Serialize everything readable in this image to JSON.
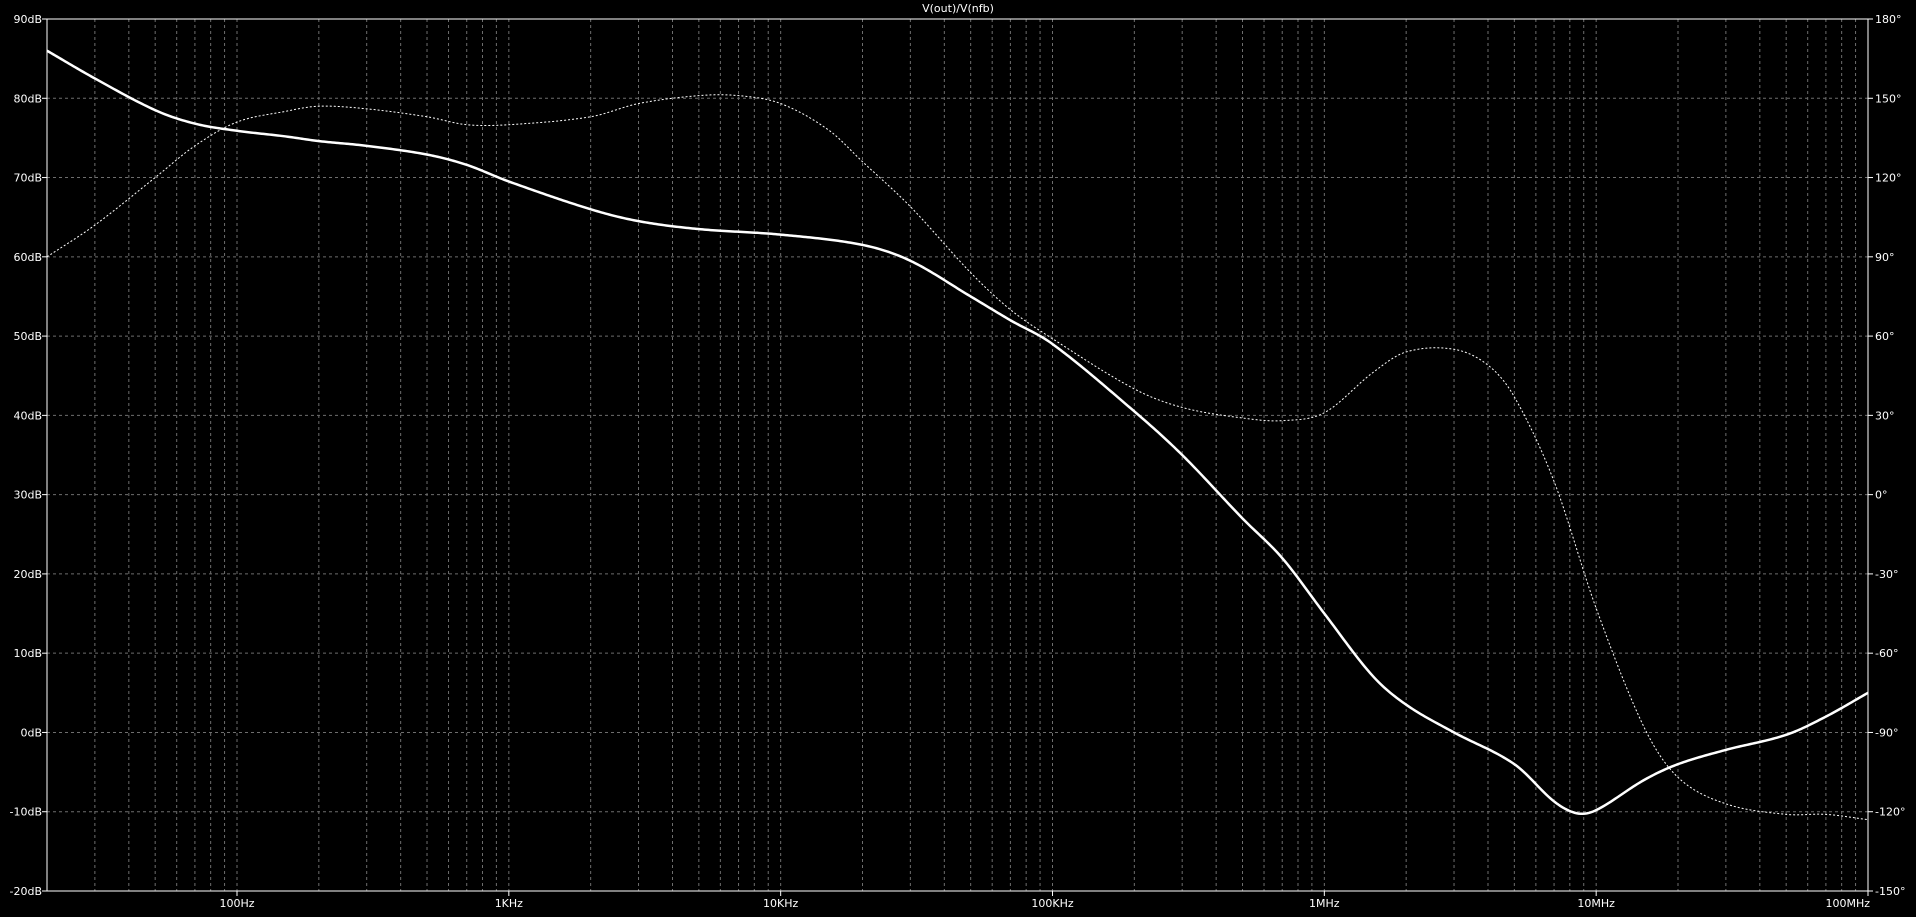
{
  "chart_data": {
    "type": "line",
    "title": "V(out)/V(nfb)",
    "x_scale": "log",
    "xlim": [
      20,
      100000000
    ],
    "ylim_left": [
      -20,
      90
    ],
    "ylim_right": [
      -150,
      180
    ],
    "left_ticks": [
      {
        "v": 90,
        "label": "90dB"
      },
      {
        "v": 80,
        "label": "80dB"
      },
      {
        "v": 70,
        "label": "70dB"
      },
      {
        "v": 60,
        "label": "60dB"
      },
      {
        "v": 50,
        "label": "50dB"
      },
      {
        "v": 40,
        "label": "40dB"
      },
      {
        "v": 30,
        "label": "30dB"
      },
      {
        "v": 20,
        "label": "20dB"
      },
      {
        "v": 10,
        "label": "10dB"
      },
      {
        "v": 0,
        "label": "0dB"
      },
      {
        "v": -10,
        "label": "-10dB"
      },
      {
        "v": -20,
        "label": "-20dB"
      }
    ],
    "right_ticks": [
      {
        "v": 180,
        "label": "180°"
      },
      {
        "v": 150,
        "label": "150°"
      },
      {
        "v": 120,
        "label": "120°"
      },
      {
        "v": 90,
        "label": "90°"
      },
      {
        "v": 60,
        "label": "60°"
      },
      {
        "v": 30,
        "label": "30°"
      },
      {
        "v": 0,
        "label": "0°"
      },
      {
        "v": -30,
        "label": "-30°"
      },
      {
        "v": -60,
        "label": "-60°"
      },
      {
        "v": -90,
        "label": "-90°"
      },
      {
        "v": -120,
        "label": "-120°"
      },
      {
        "v": -150,
        "label": "-150°"
      }
    ],
    "x_ticks": [
      {
        "v": 100,
        "label": "100Hz"
      },
      {
        "v": 1000,
        "label": "1KHz"
      },
      {
        "v": 10000,
        "label": "10KHz"
      },
      {
        "v": 100000,
        "label": "100KHz"
      },
      {
        "v": 1000000,
        "label": "1MHz"
      },
      {
        "v": 10000000,
        "label": "10MHz"
      },
      {
        "v": 100000000,
        "label": "100MHz"
      }
    ],
    "grid": true,
    "colors": {
      "background": "#000000",
      "trace": "#ffffff",
      "grid": "#6e6e6e"
    },
    "series": [
      {
        "axis": "left",
        "style": "solid",
        "x": [
          20,
          30,
          50,
          70,
          100,
          150,
          200,
          300,
          500,
          700,
          1000,
          2000,
          3000,
          5000,
          10000,
          20000,
          30000,
          50000,
          70000,
          100000,
          200000,
          300000,
          500000,
          700000,
          1000000,
          1500000,
          2000000,
          3000000,
          5000000,
          7000000,
          8500000,
          10000000,
          15000000,
          20000000,
          30000000,
          50000000,
          70000000,
          100000000
        ],
        "y": [
          86,
          82.5,
          78.5,
          76.8,
          75.9,
          75.2,
          74.6,
          74,
          72.9,
          71.6,
          69.5,
          66,
          64.5,
          63.5,
          62.8,
          61.5,
          59.5,
          55,
          52,
          49,
          40.5,
          35,
          27,
          22,
          15,
          7.2,
          3.5,
          0,
          -4,
          -8.7,
          -10.2,
          -9.8,
          -6,
          -4,
          -2.2,
          -0.3,
          2,
          5
        ]
      },
      {
        "axis": "right",
        "style": "dashed",
        "x": [
          20,
          30,
          50,
          70,
          100,
          150,
          200,
          300,
          500,
          700,
          1000,
          2000,
          3000,
          5000,
          7000,
          10000,
          15000,
          20000,
          30000,
          50000,
          70000,
          100000,
          200000,
          300000,
          500000,
          700000,
          1000000,
          1500000,
          2000000,
          3000000,
          4000000,
          5000000,
          7000000,
          10000000,
          15000000,
          20000000,
          30000000,
          50000000,
          70000000,
          100000000
        ],
        "y": [
          90,
          102,
          120,
          132,
          141,
          145,
          147,
          146,
          143,
          140,
          140,
          143,
          148,
          151,
          151,
          148,
          138,
          126,
          109,
          84,
          70,
          59,
          40,
          33,
          29,
          28,
          31,
          46,
          54,
          55,
          49,
          37,
          5,
          -43,
          -88,
          -107,
          -117,
          -121,
          -121,
          -123
        ]
      }
    ]
  }
}
